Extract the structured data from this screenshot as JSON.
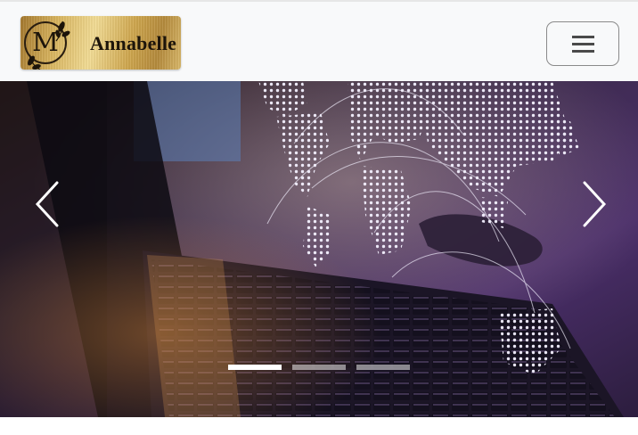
{
  "navbar": {
    "brand": {
      "monogram": "M",
      "name": "Annabelle"
    },
    "toggler": {
      "icon": "hamburger-menu-icon"
    }
  },
  "carousel": {
    "slide_count": 3,
    "active_slide": 1,
    "prev_icon": "chevron-left-icon",
    "next_icon": "chevron-right-icon",
    "slide_image": "laptop-keyboard-with-dotted-world-map"
  },
  "colors": {
    "navbar_bg": "#f8f9fa",
    "brand_gold": "#d8b45e",
    "brand_text": "#1c140a",
    "indicator": "#ffffff",
    "slide_tint": "#4b2f6a"
  }
}
